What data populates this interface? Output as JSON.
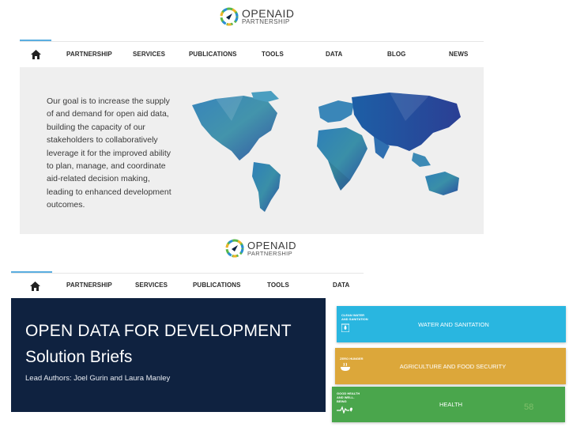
{
  "top_logo": {
    "name_top": "OPENAID",
    "name_bottom": "PARTNERSHIP"
  },
  "top_nav": {
    "items": [
      "PARTNERSHIP",
      "SERVICES",
      "PUBLICATIONS",
      "TOOLS",
      "DATA",
      "BLOG",
      "NEWS"
    ]
  },
  "hero": {
    "lines": [
      "Our goal is to increase the supply",
      "of and demand for open aid data,",
      "building the capacity of our",
      "stakeholders to collaboratively",
      "leverage it for the improved ability",
      "to plan, manage, and coordinate",
      "aid-related decision making,",
      "leading to enhanced development",
      "outcomes."
    ]
  },
  "second_logo": {
    "name_top": "OPENAID",
    "name_bottom": "PARTNERSHIP"
  },
  "second_nav": {
    "items": [
      "PARTNERSHIP",
      "SERVICES",
      "PUBLICATIONS",
      "TOOLS",
      "DATA"
    ]
  },
  "report": {
    "title": "OPEN DATA FOR DEVELOPMENT",
    "subtitle": "Solution Briefs",
    "authors": "Lead Authors: Joel Gurin and Laura Manley"
  },
  "sdg_tiles": [
    {
      "small": "CLEAN WATER AND SANITATION",
      "title": "WATER AND SANITATION",
      "color": "#29b6e0",
      "icon": "water-drop-icon"
    },
    {
      "small": "ZERO HUNGER",
      "title": "AGRICULTURE AND FOOD SECURITY",
      "color": "#dca73a",
      "icon": "food-bowl-icon"
    },
    {
      "small": "GOOD HEALTH AND WELL-BEING",
      "title": "HEALTH",
      "color": "#4aa64c",
      "icon": "heartbeat-icon"
    }
  ],
  "page_number": "58",
  "colors": {
    "report_bg": "#0f2240",
    "nav_accent": "#5aaee0",
    "hero_bg": "#efefef"
  }
}
